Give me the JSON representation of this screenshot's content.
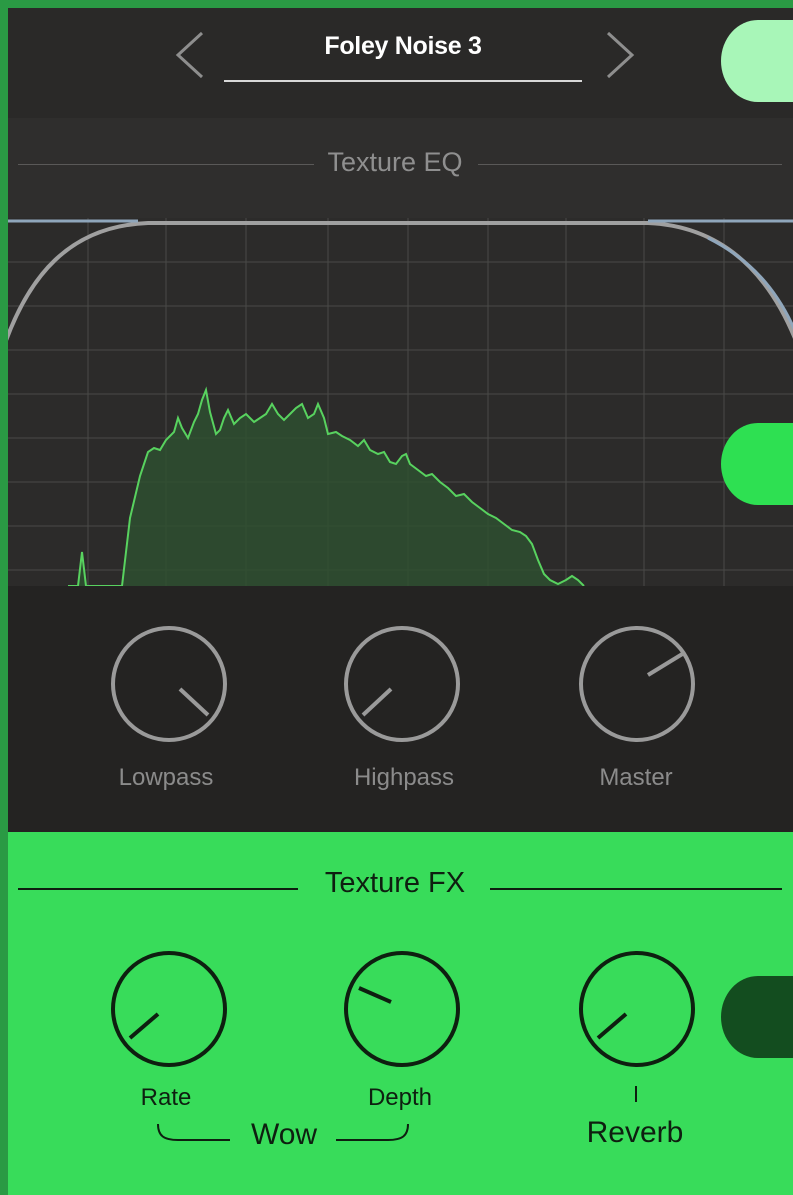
{
  "header": {
    "preset_name": "Foley Noise 3",
    "prev_icon": "chevron-left-icon",
    "next_icon": "chevron-right-icon"
  },
  "texture_eq": {
    "title": "Texture EQ",
    "knobs": [
      {
        "label": "Lowpass",
        "level": 0.82
      },
      {
        "label": "Highpass",
        "level": 0.2
      },
      {
        "label": "Master",
        "level": 0.68
      }
    ]
  },
  "texture_fx": {
    "title": "Texture FX",
    "knobs": [
      {
        "label": "Rate",
        "level": 0.22
      },
      {
        "label": "Depth",
        "level": 0.38
      },
      {
        "label": "Reverb",
        "level": 0.22
      }
    ],
    "group_label": "Wow",
    "reverb_label": "Reverb"
  },
  "indicators": [
    {
      "name": "top-indicator",
      "color": "#a8f6b8"
    },
    {
      "name": "mid-indicator",
      "color": "#2ee052"
    },
    {
      "name": "fx-indicator",
      "color": "#134d1f"
    }
  ],
  "colors": {
    "background": "#2a9a44",
    "panel_dark": "#2a2928",
    "fx_panel": "#38dc5a",
    "spectrum": "#58d25f",
    "filter_curve": "#8fa6bb"
  }
}
